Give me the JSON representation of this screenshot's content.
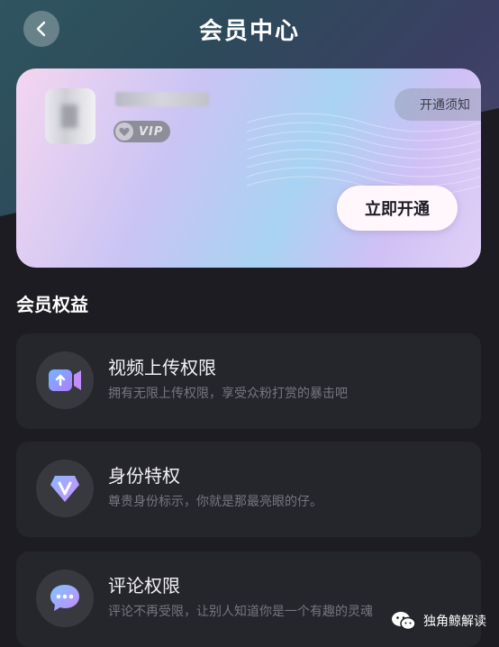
{
  "header": {
    "title": "会员中心"
  },
  "card": {
    "vip_label": "VIP",
    "notice_label": "开通须知",
    "open_label": "立即开通"
  },
  "section": {
    "title": "会员权益"
  },
  "benefits": [
    {
      "title": "视频上传权限",
      "desc": "拥有无限上传权限，享受众粉打赏的暴击吧",
      "icon": "video-upload-icon"
    },
    {
      "title": "身份特权",
      "desc": "尊贵身份标示，你就是那最亮眼的仔。",
      "icon": "vip-diamond-icon"
    },
    {
      "title": "评论权限",
      "desc": "评论不再受限，让别人知道你是一个有趣的灵魂",
      "icon": "comment-bubble-icon"
    }
  ],
  "watermark": {
    "text": "独角鲸解读"
  },
  "colors": {
    "background": "#1c1c22",
    "card_gradient": [
      "#f4d6f0",
      "#a9d3f2",
      "#cfc0f5"
    ],
    "accent_purple": "#8a6bff"
  }
}
